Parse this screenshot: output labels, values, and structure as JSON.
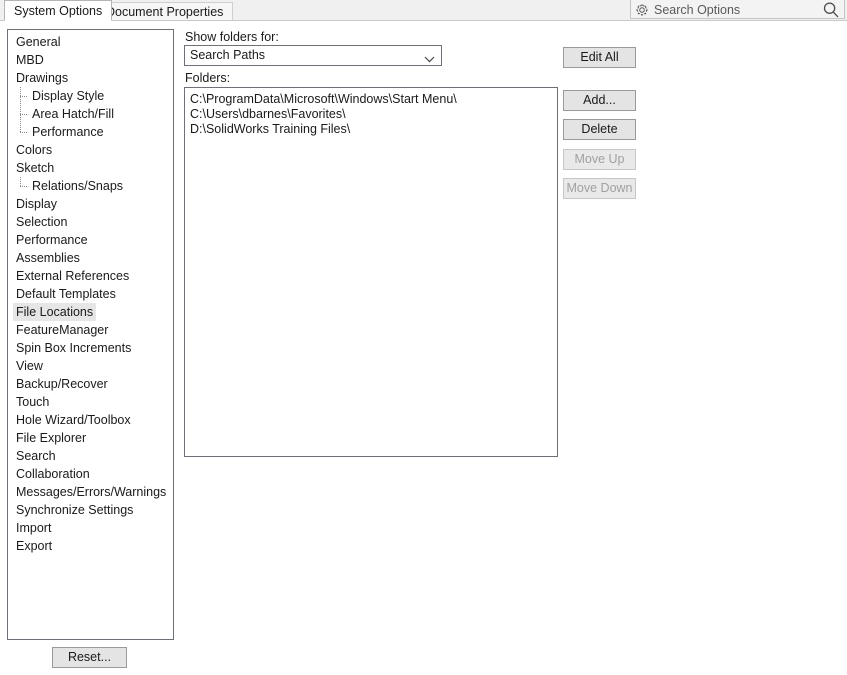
{
  "tabs": [
    {
      "label": "System Options",
      "active": true
    },
    {
      "label": "Document Properties",
      "active": false
    }
  ],
  "search": {
    "placeholder": "Search Options",
    "value": "",
    "gear_icon": "gear-icon",
    "magnifier_icon": "magnifier-icon"
  },
  "sidebar": {
    "items": [
      {
        "label": "General",
        "level": 0,
        "selected": false
      },
      {
        "label": "MBD",
        "level": 0,
        "selected": false
      },
      {
        "label": "Drawings",
        "level": 0,
        "selected": false
      },
      {
        "label": "Display Style",
        "level": 1,
        "selected": false
      },
      {
        "label": "Area Hatch/Fill",
        "level": 1,
        "selected": false
      },
      {
        "label": "Performance",
        "level": 1,
        "selected": false,
        "last": true
      },
      {
        "label": "Colors",
        "level": 0,
        "selected": false
      },
      {
        "label": "Sketch",
        "level": 0,
        "selected": false
      },
      {
        "label": "Relations/Snaps",
        "level": 1,
        "selected": false,
        "last": true
      },
      {
        "label": "Display",
        "level": 0,
        "selected": false
      },
      {
        "label": "Selection",
        "level": 0,
        "selected": false
      },
      {
        "label": "Performance",
        "level": 0,
        "selected": false
      },
      {
        "label": "Assemblies",
        "level": 0,
        "selected": false
      },
      {
        "label": "External References",
        "level": 0,
        "selected": false
      },
      {
        "label": "Default Templates",
        "level": 0,
        "selected": false
      },
      {
        "label": "File Locations",
        "level": 0,
        "selected": true
      },
      {
        "label": "FeatureManager",
        "level": 0,
        "selected": false
      },
      {
        "label": "Spin Box Increments",
        "level": 0,
        "selected": false
      },
      {
        "label": "View",
        "level": 0,
        "selected": false
      },
      {
        "label": "Backup/Recover",
        "level": 0,
        "selected": false
      },
      {
        "label": "Touch",
        "level": 0,
        "selected": false
      },
      {
        "label": "Hole Wizard/Toolbox",
        "level": 0,
        "selected": false
      },
      {
        "label": "File Explorer",
        "level": 0,
        "selected": false
      },
      {
        "label": "Search",
        "level": 0,
        "selected": false
      },
      {
        "label": "Collaboration",
        "level": 0,
        "selected": false
      },
      {
        "label": "Messages/Errors/Warnings",
        "level": 0,
        "selected": false
      },
      {
        "label": "Synchronize Settings",
        "level": 0,
        "selected": false
      },
      {
        "label": "Import",
        "level": 0,
        "selected": false
      },
      {
        "label": "Export",
        "level": 0,
        "selected": false
      }
    ]
  },
  "reset": {
    "label": "Reset..."
  },
  "main": {
    "show_folders_label": "Show folders for:",
    "show_folders_value": "Search Paths",
    "show_folders_options": [
      "Search Paths"
    ],
    "folders_label": "Folders:",
    "folders": [
      "C:\\ProgramData\\Microsoft\\Windows\\Start Menu\\",
      "C:\\Users\\dbarnes\\Favorites\\",
      "D:\\SolidWorks Training Files\\"
    ],
    "buttons": {
      "edit_all": "Edit All",
      "add": "Add...",
      "delete": "Delete",
      "move_up": "Move Up",
      "move_down": "Move Down"
    }
  },
  "colors": {
    "window_bg": "#ffffff",
    "tabstrip_bg": "#f0f0f0",
    "button_face": "#e4e4e4",
    "selection_bg": "#e6e6e6",
    "border": "#6d7278",
    "disabled_text": "#a0a0a0"
  }
}
